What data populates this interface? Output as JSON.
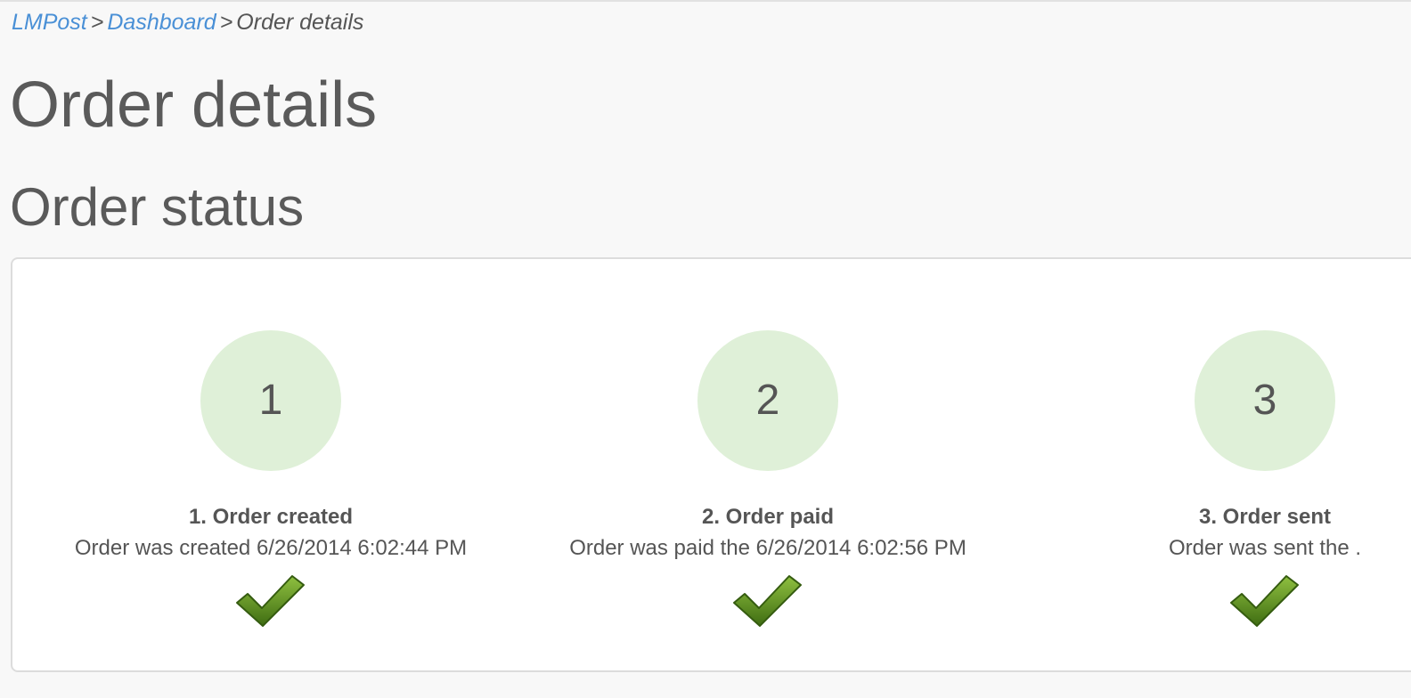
{
  "breadcrumb": {
    "home": "LMPost",
    "separator": ">",
    "dashboard": "Dashboard",
    "current": "Order details"
  },
  "page_title": "Order details",
  "section_title": "Order status",
  "colors": {
    "link": "#4a90d6",
    "circle_fill": "#dff0d8",
    "check_green": "#5a8f1e"
  },
  "steps": [
    {
      "number": "1",
      "title": "1. Order created",
      "description": "Order was created 6/26/2014 6:02:44 PM",
      "icon": "checkmark-icon"
    },
    {
      "number": "2",
      "title": "2. Order paid",
      "description": "Order was paid the 6/26/2014 6:02:56 PM",
      "icon": "checkmark-icon"
    },
    {
      "number": "3",
      "title": "3. Order sent",
      "description": "Order was sent the .",
      "icon": "checkmark-icon"
    }
  ]
}
